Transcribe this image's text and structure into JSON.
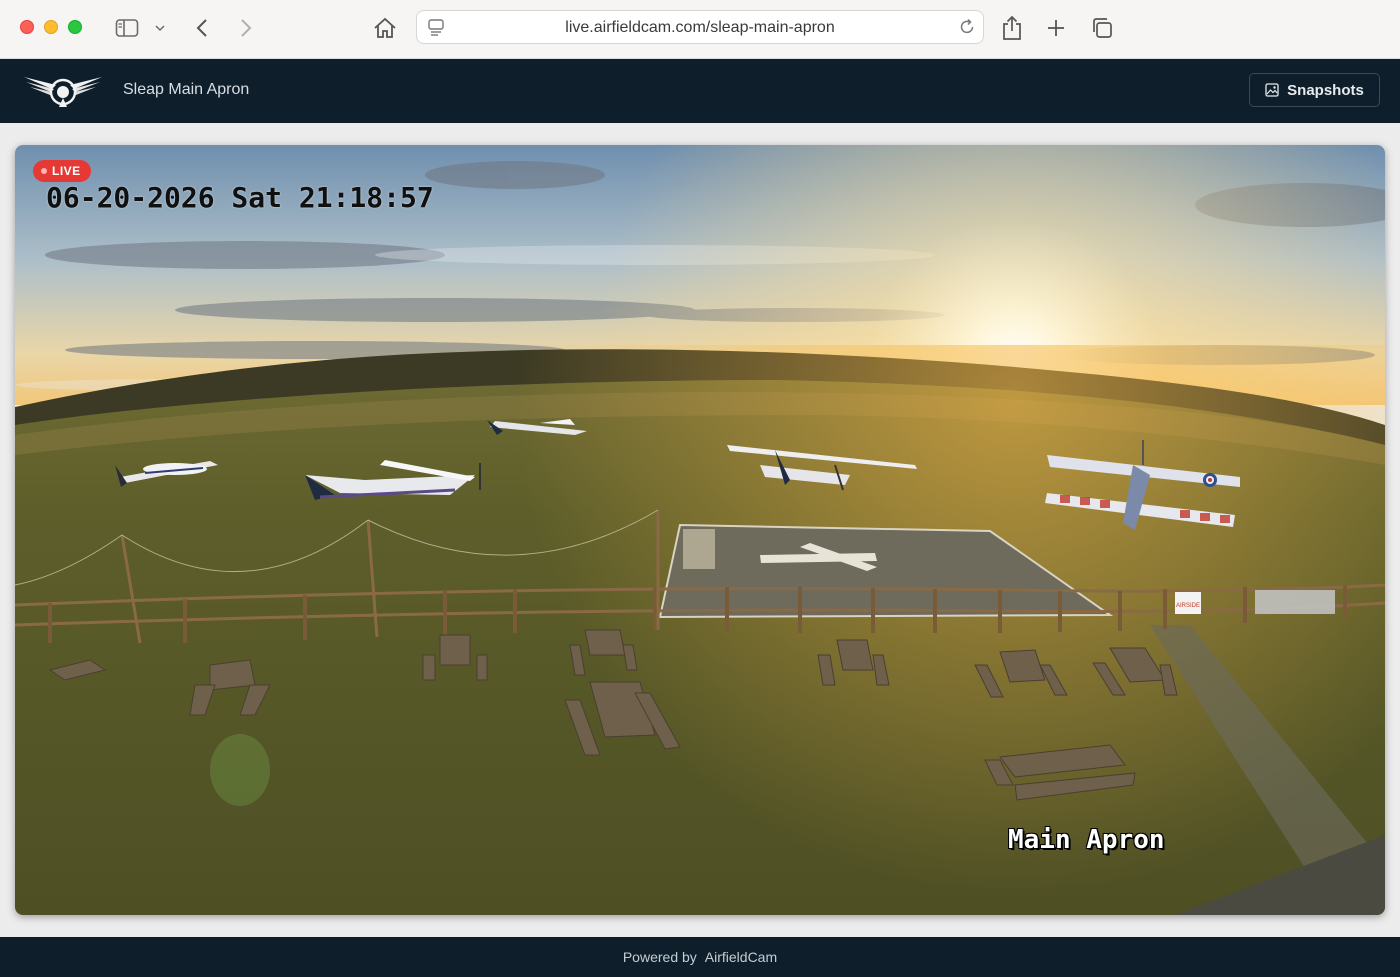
{
  "browser": {
    "url": "live.airfieldcam.com/sleap-main-apron"
  },
  "app": {
    "title": "Sleap Main Apron",
    "snapshots_label": "Snapshots"
  },
  "stream": {
    "live_label": "LIVE",
    "timestamp": "06-20-2026 Sat 21:18:57",
    "camera_label": "Main Apron",
    "airside_sign": "AIRSIDE"
  },
  "footer": {
    "powered_by": "Powered by",
    "brand": "AirfieldCam"
  },
  "colors": {
    "header_bg": "#0e1f2b",
    "live_badge": "#e53935"
  }
}
